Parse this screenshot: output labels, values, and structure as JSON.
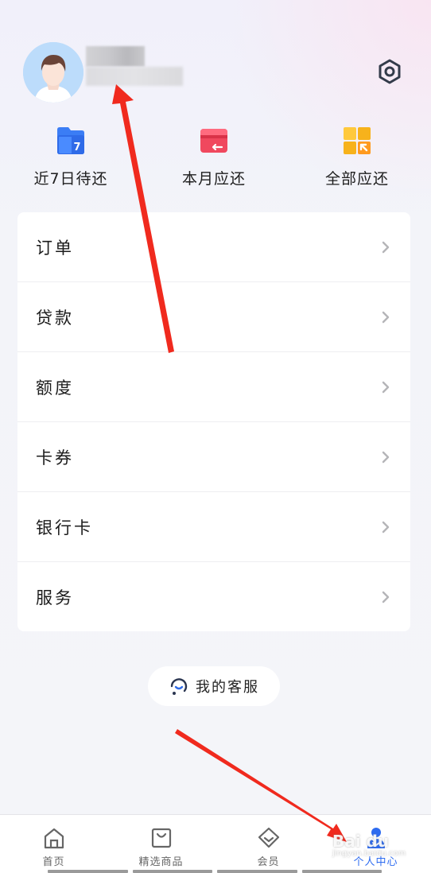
{
  "profile": {
    "settings_icon": "hexagon-gear-icon"
  },
  "quick_actions": [
    {
      "label": "近7日待还",
      "icon": "calendar-7-icon",
      "color": "#3b7df5"
    },
    {
      "label": "本月应还",
      "icon": "card-return-icon",
      "color": "#f0485e"
    },
    {
      "label": "全部应还",
      "icon": "grid-arrow-icon",
      "color": "#f7b21b"
    }
  ],
  "menu": {
    "items": [
      {
        "label": "订单"
      },
      {
        "label": "贷款"
      },
      {
        "label": "额度"
      },
      {
        "label": "卡券"
      },
      {
        "label": "银行卡"
      },
      {
        "label": "服务"
      }
    ],
    "chevron_icon": "chevron-right-icon"
  },
  "customer_service": {
    "label": "我的客服",
    "icon": "headset-smile-icon"
  },
  "tabbar": {
    "items": [
      {
        "label": "首页",
        "icon": "home-icon",
        "active": false
      },
      {
        "label": "精选商品",
        "icon": "shopping-bag-icon",
        "active": false
      },
      {
        "label": "会员",
        "icon": "diamond-tag-icon",
        "active": false
      },
      {
        "label": "个人中心",
        "icon": "person-icon",
        "active": true
      }
    ],
    "active_color": "#2d6bf0"
  },
  "annotations": {
    "arrow_color": "#f02a1e"
  },
  "watermark": {
    "main": "Bai du",
    "sub": "jingyan.baidu.com"
  }
}
